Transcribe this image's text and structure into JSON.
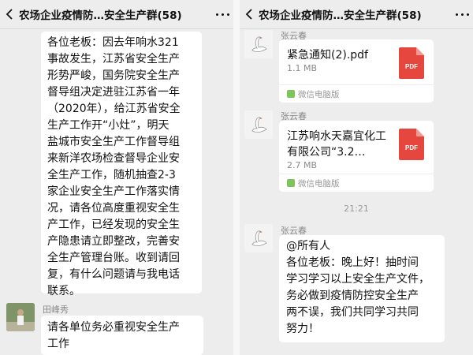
{
  "left": {
    "title": "农场企业疫情防…安全生产群(58)",
    "msg1_lines": [
      "各位老板：因去年响水321",
      "事故发生，江苏省安全生产",
      "形势严峻，国务院安全生产",
      "督导组决定进驻江苏省一年",
      "（2020年），给江苏省安全",
      "生产工作开“小灶”，明天",
      "盐城市安全生产工作督导组",
      "来新洋农场检查督导企业安",
      "全生产工作，随机抽查2-3",
      "家企业安全生产工作落实情",
      "况，请各位高度重视安全生",
      "产工作，已经发现的安全生",
      "产隐患请立即整改，完善安",
      "全生产管理台账。收到请回",
      "复，有什么问题请与我电话",
      "联系。"
    ],
    "sender2": "田峰秀",
    "msg2_lines": [
      "请各单位务必重视安全生产",
      "工作"
    ]
  },
  "right": {
    "title": "农场企业疫情防…安全生产群(58)",
    "sender": "张云春",
    "file1": {
      "name": "紧急通知(2).pdf",
      "size": "1.1 MB",
      "source": "微信电脑版",
      "icon": "PDF"
    },
    "file2": {
      "name": "江苏响水天嘉宜化工有限公司“3.2…",
      "size": "2.7 MB",
      "source": "微信电脑版",
      "icon": "PDF"
    },
    "time": "21:21",
    "msg_lines": [
      "@所有人",
      "各位老板：晚上好！抽时间",
      "学习学习以上安全生产文件，",
      "务必做到疫情防控安全生产",
      "两不误，我们共同学习共同",
      "努力！"
    ]
  }
}
